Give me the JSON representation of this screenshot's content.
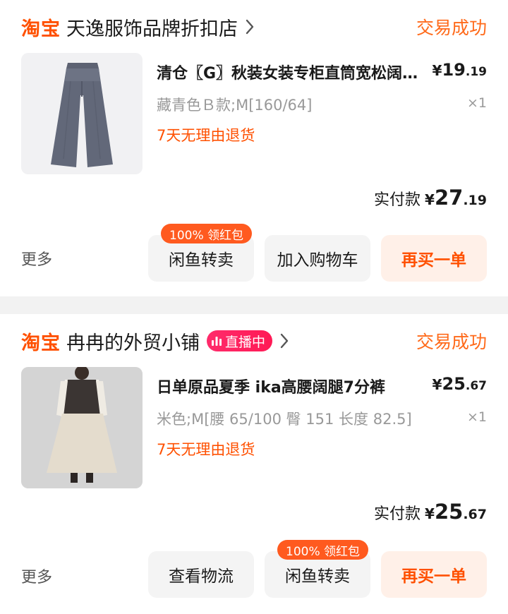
{
  "orders": [
    {
      "shop_logo": "淘宝",
      "shop_name": "天逸服饰品牌折扣店",
      "status": "交易成功",
      "item": {
        "title": "清仓〖G〗秋装女装专柜直筒宽松阔腿裤",
        "price_currency": "¥",
        "price_whole": "19",
        "price_cents": ".19",
        "sku": "藏青色Ｂ款;M[160/64]",
        "qty": "×1",
        "refund_policy": "7天无理由退货"
      },
      "paid_label": "实付款",
      "paid_currency": "¥",
      "paid_whole": "27",
      "paid_cents": ".19",
      "more_label": "更多",
      "buttons": [
        "闲鱼转卖",
        "加入购物车",
        "再买一单"
      ],
      "promo_badge": "100% 领红包"
    },
    {
      "shop_logo": "淘宝",
      "shop_name": "冉冉的外贸小铺",
      "live_badge": "直播中",
      "status": "交易成功",
      "item": {
        "title": "日单原品夏季 ika高腰阔腿7分裤",
        "price_currency": "¥",
        "price_whole": "25",
        "price_cents": ".67",
        "sku": "米色;M[腰 65/100 臀 151 长度 82.5]",
        "qty": "×1",
        "refund_policy": "7天无理由退货"
      },
      "paid_label": "实付款",
      "paid_currency": "¥",
      "paid_whole": "25",
      "paid_cents": ".67",
      "more_label": "更多",
      "buttons": [
        "查看物流",
        "闲鱼转卖",
        "再买一单"
      ],
      "promo_badge": "100% 领红包"
    }
  ],
  "icons": {
    "chevron": "chevron-right-icon",
    "live": "live-bars-icon"
  },
  "colors": {
    "brand_orange": "#ff5000",
    "status_orange": "#ff6a1a",
    "live_pink": "#ff1a55",
    "button_gray": "#f4f4f4"
  }
}
